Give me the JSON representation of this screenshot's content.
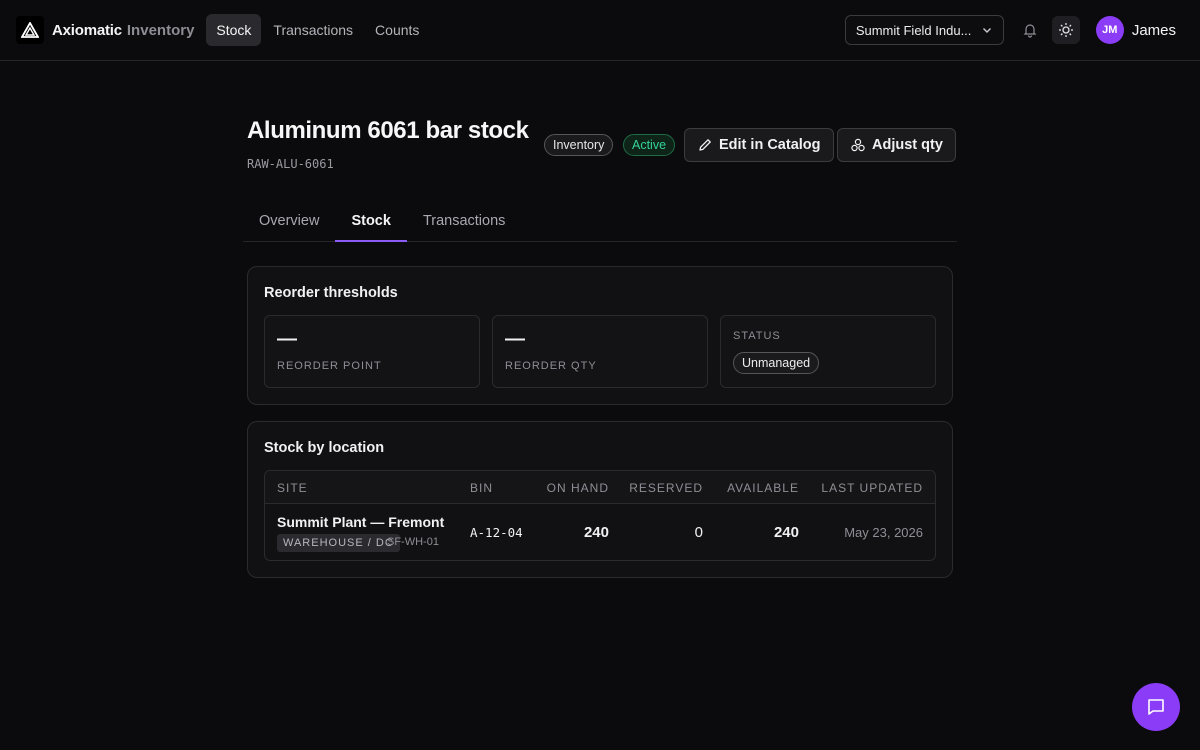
{
  "topbar": {
    "brand": "Axiomatic",
    "brand_sub": "Inventory",
    "nav": [
      "Stock",
      "Transactions",
      "Counts"
    ],
    "active_nav": "Stock",
    "org_select": "Summit Field Indu...",
    "user": {
      "initials": "JM",
      "name": "James"
    }
  },
  "item": {
    "title": "Aluminum 6061 bar stock",
    "sku": "RAW-ALU-6061",
    "badges": {
      "inventory": "Inventory",
      "status": "Active"
    },
    "actions": {
      "edit": "Edit in Catalog",
      "adjust": "Adjust qty"
    }
  },
  "tabs": [
    "Overview",
    "Stock",
    "Transactions"
  ],
  "reorder": {
    "title": "Reorder thresholds",
    "reorder_point": {
      "value": "—",
      "label": "REORDER POINT"
    },
    "reorder_qty": {
      "value": "—",
      "label": "REORDER QTY"
    },
    "status": {
      "label": "STATUS",
      "value": "Unmanaged"
    }
  },
  "stock_by_location": {
    "title": "Stock by location",
    "columns": [
      "SITE",
      "BIN",
      "ON HAND",
      "RESERVED",
      "AVAILABLE",
      "LAST UPDATED"
    ],
    "rows": [
      {
        "site": "Summit Plant — Fremont",
        "site_type": "WAREHOUSE / DC",
        "site_code": "SF-WH-01",
        "bin": "A-12-04",
        "on_hand": "240",
        "reserved": "0",
        "available": "240",
        "last_updated": "May 23, 2026"
      }
    ]
  },
  "colors": {
    "accent": "#8b5cf6",
    "fab": "#8b3cf6",
    "active_green": "#34d399"
  }
}
